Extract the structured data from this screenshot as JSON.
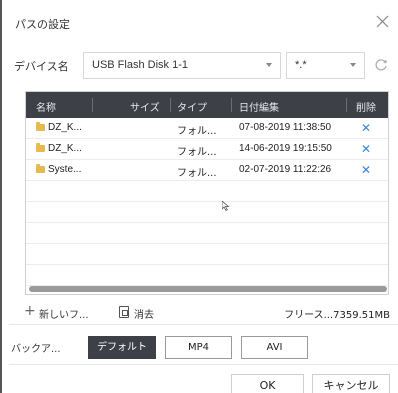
{
  "dialog": {
    "title": "パスの設定"
  },
  "device": {
    "label": "デバイス名",
    "name_value": "USB Flash Disk 1-1",
    "filter_value": "*.*"
  },
  "table": {
    "headers": {
      "name": "名称",
      "size": "サイズ",
      "type": "タイプ",
      "date": "日付編集",
      "delete": "削除"
    },
    "rows": [
      {
        "name": "DZ_K...",
        "size": "",
        "type": "フォル...",
        "date": "07-08-2019 11:38:50"
      },
      {
        "name": "DZ_K...",
        "size": "",
        "type": "フォル...",
        "date": "14-06-2019 19:15:50"
      },
      {
        "name": "Syste...",
        "size": "",
        "type": "フォル...",
        "date": "02-07-2019 11:22:26"
      }
    ]
  },
  "actions": {
    "new_folder": "新しいフ...",
    "erase": "消去",
    "free_space": "フリース...7359.51MB"
  },
  "backup": {
    "label": "バックア...",
    "options": [
      "デフォルト",
      "MP4",
      "AVI"
    ],
    "selected": "デフォルト"
  },
  "footer": {
    "ok": "OK",
    "cancel": "キャンセル"
  },
  "icons": {
    "close": "close-icon",
    "refresh": "refresh-icon",
    "folder": "folder-icon",
    "delete": "close-x-icon",
    "new": "plus-icon",
    "erase": "document-icon"
  },
  "colors": {
    "header_bg": "#3d4147",
    "accent": "#3a86d6",
    "folder": "#e7b94e"
  }
}
